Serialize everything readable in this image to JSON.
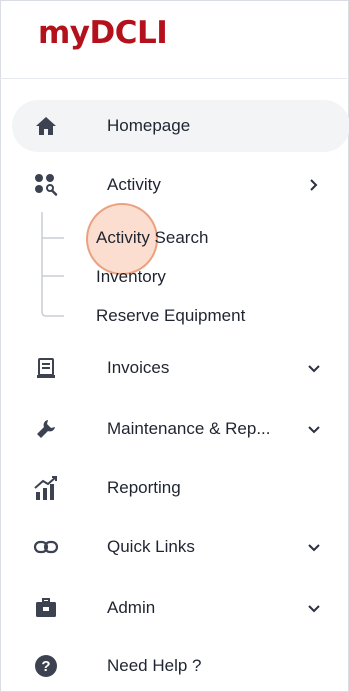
{
  "app": {
    "logo_text": "myDCLI"
  },
  "nav": {
    "items": [
      {
        "id": "homepage",
        "label": "Homepage",
        "icon": "home-icon",
        "active": true
      },
      {
        "id": "activity",
        "label": "Activity",
        "icon": "activity-search-icon",
        "chevron": "chevron-right-icon"
      },
      {
        "id": "invoices",
        "label": "Invoices",
        "icon": "invoice-icon",
        "chevron": "chevron-down-icon"
      },
      {
        "id": "maintenance",
        "label": "Maintenance & Rep...",
        "icon": "wrench-icon",
        "chevron": "chevron-down-icon"
      },
      {
        "id": "reporting",
        "label": "Reporting",
        "icon": "chart-icon"
      },
      {
        "id": "quick-links",
        "label": "Quick Links",
        "icon": "link-icon",
        "chevron": "chevron-down-icon"
      },
      {
        "id": "admin",
        "label": "Admin",
        "icon": "briefcase-icon",
        "chevron": "chevron-down-icon"
      },
      {
        "id": "help",
        "label": "Need Help ?",
        "icon": "help-icon"
      }
    ],
    "activity_sub": [
      {
        "label": "Activity Search"
      },
      {
        "label": "Inventory"
      },
      {
        "label": "Reserve Equipment"
      }
    ]
  },
  "colors": {
    "brand_red": "#b3121d",
    "active_bg": "#f2f4f6",
    "click_ring": "#f5a078"
  }
}
